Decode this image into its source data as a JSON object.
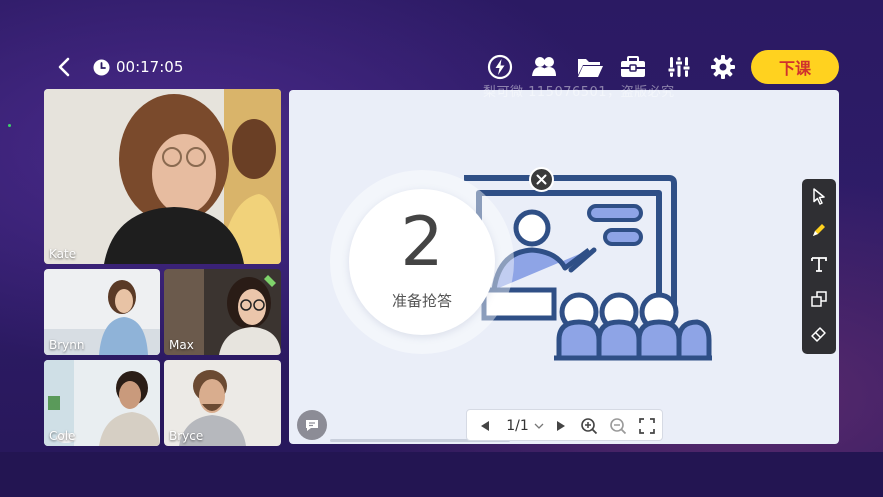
{
  "header": {
    "timer": "00:17:05",
    "end_class_label": "下课",
    "toolbar_icons": [
      "lightning-icon",
      "students-icon",
      "folder-icon",
      "toolbox-icon",
      "mixer-icon",
      "settings-icon"
    ]
  },
  "watermark": "梨可微 115076501，盗版必究",
  "participants": [
    {
      "name": "Kate"
    },
    {
      "name": "Brynn"
    },
    {
      "name": "Max"
    },
    {
      "name": "Cole"
    },
    {
      "name": "Bryce"
    }
  ],
  "countdown": {
    "number": "2",
    "label": "准备抢答"
  },
  "pager": {
    "page": "1/1"
  },
  "palette": [
    "pointer-icon",
    "pen-icon",
    "text-icon",
    "shape-icon",
    "eraser-icon"
  ],
  "colors": {
    "accent": "#ffd21f",
    "end_text": "#d0312d",
    "board_bg": "#eaeef8",
    "illustration_stroke": "#2f4f86",
    "illustration_fill": "#8ea4e6"
  }
}
